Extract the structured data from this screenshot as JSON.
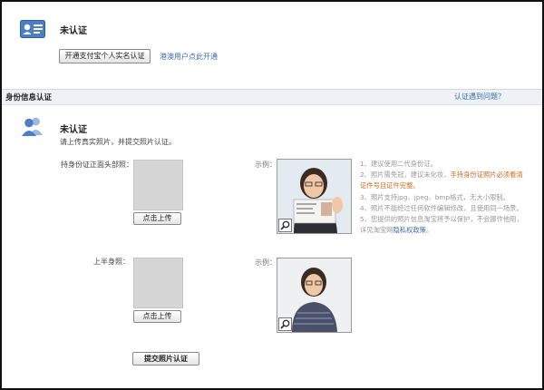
{
  "top": {
    "status": "未认证",
    "open_button": "开通支付宝个人实名认证",
    "hk_link": "港澳用户点此开通"
  },
  "section": {
    "title": "身份信息认证",
    "help_link": "认证遇到问题？"
  },
  "identity": {
    "status": "未认证",
    "instruction": "请上传真实照片，并提交照片认证。"
  },
  "upload1": {
    "label": "持身份证正面头部照：",
    "button": "点击上传",
    "example_label": "示例："
  },
  "upload2": {
    "label": "上半身照：",
    "button": "点击上传",
    "example_label": "示例："
  },
  "tips": {
    "t1": "1、建议使用二代身份证。",
    "t2a": "2、照片需免冠，建议未化妆，",
    "t2b": "手持身份证照片必须看清证件号且证件完整。",
    "t3": "3、照片支持jpg、jpeg、bmp格式，无大小限制。",
    "t4": "4、照片不能经过任何软件编辑修改，且使用同一场景。",
    "t5a": "5、您提供的照片信息淘宝将予以保护，不会挪作他用，详见淘宝网",
    "t5b": "隐私权政策",
    "t5c": "。"
  },
  "submit_button": "提交照片认证",
  "colors": {
    "link": "#3a6ea5",
    "highlight": "#d2691e",
    "section_bar": "#eef2f6",
    "placeholder": "#d6d6d6"
  },
  "icons": {
    "top": "id-card-icon",
    "identity": "users-icon",
    "preview": "magnifier-icon"
  }
}
